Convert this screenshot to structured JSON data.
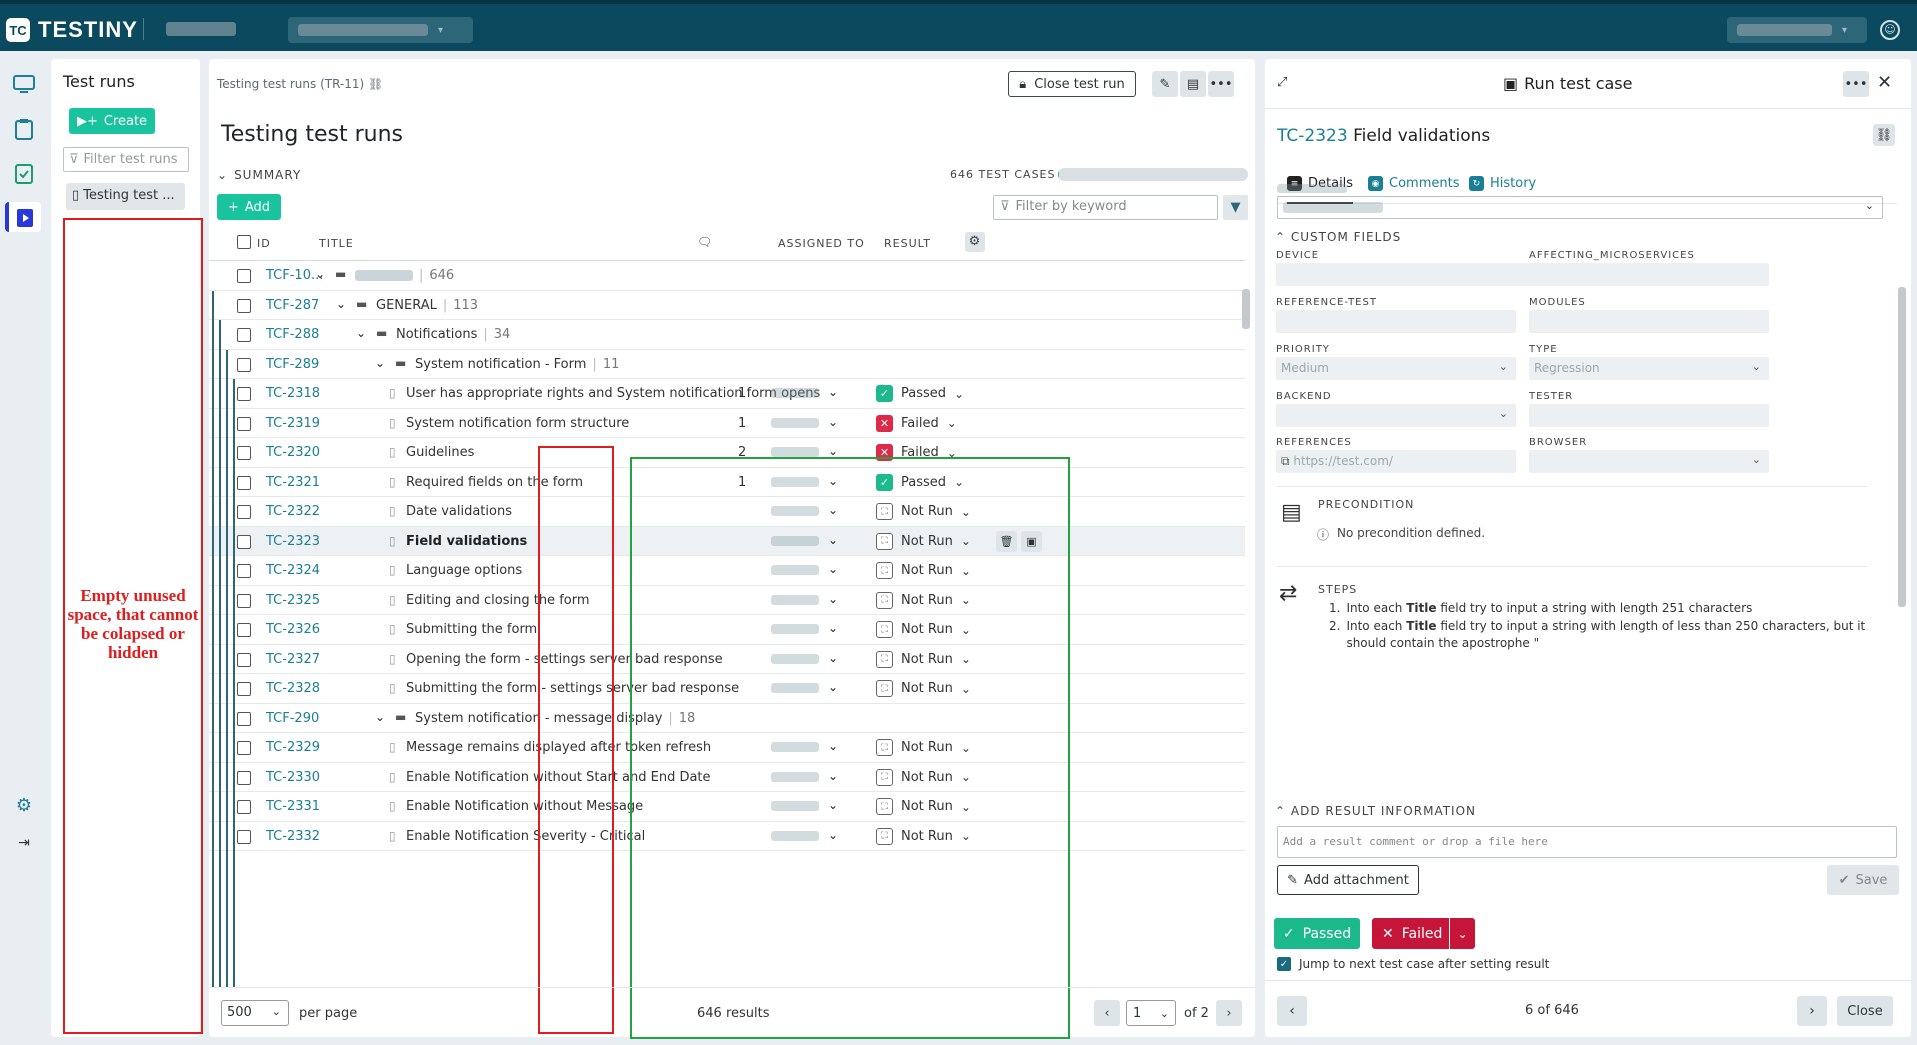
{
  "topbar": {
    "logo_text": "TESTINY",
    "logo_mark": "TC"
  },
  "nav": {
    "icons": [
      "dashboard-icon",
      "test-cases-icon",
      "test-plans-icon",
      "test-runs-icon",
      "settings-icon",
      "logout-icon"
    ]
  },
  "runs_panel": {
    "title": "Test runs",
    "create_label": "Create",
    "filter_placeholder": "Filter test runs",
    "item_label": "Testing test ...",
    "annotation": "Empty unused space, that cannot be colapsed or hidden"
  },
  "main": {
    "breadcrumb": "Testing test runs (TR-11)",
    "close_run_label": "Close test run",
    "title": "Testing test runs",
    "summary_label": "SUMMARY",
    "test_case_count": "646 TEST CASES",
    "progress_fraction": 0.006,
    "add_label": "Add",
    "keyword_placeholder": "Filter by keyword",
    "columns": {
      "id": "ID",
      "title": "TITLE",
      "assigned": "ASSIGNED TO",
      "result": "RESULT"
    },
    "rows": [
      {
        "id": "TCF-10...",
        "type": "folder",
        "level": 0,
        "title": "",
        "count": "646"
      },
      {
        "id": "TCF-287",
        "type": "folder",
        "level": 1,
        "title": "GENERAL",
        "count": "113"
      },
      {
        "id": "TCF-288",
        "type": "folder",
        "level": 2,
        "title": "Notifications",
        "count": "34"
      },
      {
        "id": "TCF-289",
        "type": "folder",
        "level": 3,
        "title": "System notification - Form",
        "count": "11"
      },
      {
        "id": "TC-2318",
        "type": "case",
        "title": "User has appropriate rights and System notification form opens",
        "comments": "1",
        "result": "Passed",
        "status": "pass"
      },
      {
        "id": "TC-2319",
        "type": "case",
        "title": "System notification form structure",
        "comments": "1",
        "result": "Failed",
        "status": "fail"
      },
      {
        "id": "TC-2320",
        "type": "case",
        "title": "Guidelines",
        "comments": "2",
        "result": "Failed",
        "status": "fail"
      },
      {
        "id": "TC-2321",
        "type": "case",
        "title": "Required fields on the form",
        "comments": "1",
        "result": "Passed",
        "status": "pass"
      },
      {
        "id": "TC-2322",
        "type": "case",
        "title": "Date validations",
        "comments": "",
        "result": "Not Run",
        "status": "nr"
      },
      {
        "id": "TC-2323",
        "type": "case",
        "title": "Field validations",
        "comments": "",
        "result": "Not Run",
        "status": "nr",
        "selected": true
      },
      {
        "id": "TC-2324",
        "type": "case",
        "title": "Language options",
        "comments": "",
        "result": "Not Run",
        "status": "nr"
      },
      {
        "id": "TC-2325",
        "type": "case",
        "title": "Editing and closing the form",
        "comments": "",
        "result": "Not Run",
        "status": "nr"
      },
      {
        "id": "TC-2326",
        "type": "case",
        "title": "Submitting the form",
        "comments": "",
        "result": "Not Run",
        "status": "nr"
      },
      {
        "id": "TC-2327",
        "type": "case",
        "title": "Opening the form - settings server bad response",
        "comments": "",
        "result": "Not Run",
        "status": "nr"
      },
      {
        "id": "TC-2328",
        "type": "case",
        "title": "Submitting the form - settings server bad response",
        "comments": "",
        "result": "Not Run",
        "status": "nr"
      },
      {
        "id": "TCF-290",
        "type": "folder",
        "level": 3,
        "title": "System notification - message display",
        "count": "18"
      },
      {
        "id": "TC-2329",
        "type": "case",
        "title": "Message remains displayed after token refresh",
        "comments": "",
        "result": "Not Run",
        "status": "nr"
      },
      {
        "id": "TC-2330",
        "type": "case",
        "title": "Enable Notification without Start and End Date",
        "comments": "",
        "result": "Not Run",
        "status": "nr"
      },
      {
        "id": "TC-2331",
        "type": "case",
        "title": "Enable Notification without Message",
        "comments": "",
        "result": "Not Run",
        "status": "nr"
      },
      {
        "id": "TC-2332",
        "type": "case",
        "title": "Enable Notification Severity - Critical",
        "comments": "",
        "result": "Not Run",
        "status": "nr"
      }
    ],
    "per_page": "500",
    "per_page_label": "per page",
    "results_label": "646 results",
    "page": "1",
    "of_pages": "of 2"
  },
  "detail": {
    "header": "Run test case",
    "case_id": "TC-2323",
    "case_title": "Field validations",
    "tabs": [
      "Details",
      "Comments",
      "History"
    ],
    "custom_fields_label": "CUSTOM FIELDS",
    "fields": {
      "device": "DEVICE",
      "affecting": "AFFECTING_MICROSERVICES",
      "reference_test": "REFERENCE-TEST",
      "modules": "MODULES",
      "priority": "PRIORITY",
      "priority_value": "Medium",
      "type": "TYPE",
      "type_value": "Regression",
      "backend": "BACKEND",
      "tester": "TESTER",
      "references": "REFERENCES",
      "references_value": "https://test.com/",
      "browser": "BROWSER"
    },
    "precondition_label": "PRECONDITION",
    "precondition_text": "No precondition defined.",
    "steps_label": "STEPS",
    "steps": [
      {
        "pre": "Into each ",
        "bold": "Title",
        "post": " field try to input a string with length 251 characters"
      },
      {
        "pre": "Into each ",
        "bold": "Title",
        "post": " field try to input a string with length of less than 250 characters, but it should contain the apostrophe \""
      }
    ],
    "add_result_label": "ADD RESULT INFORMATION",
    "comment_placeholder": "Add a result comment or drop a file here",
    "attach_label": "Add attachment",
    "save_label": "Save",
    "passed_label": "Passed",
    "failed_label": "Failed",
    "jump_label": "Jump to next test case after setting result",
    "position": "6 of 646",
    "close_label": "Close"
  }
}
